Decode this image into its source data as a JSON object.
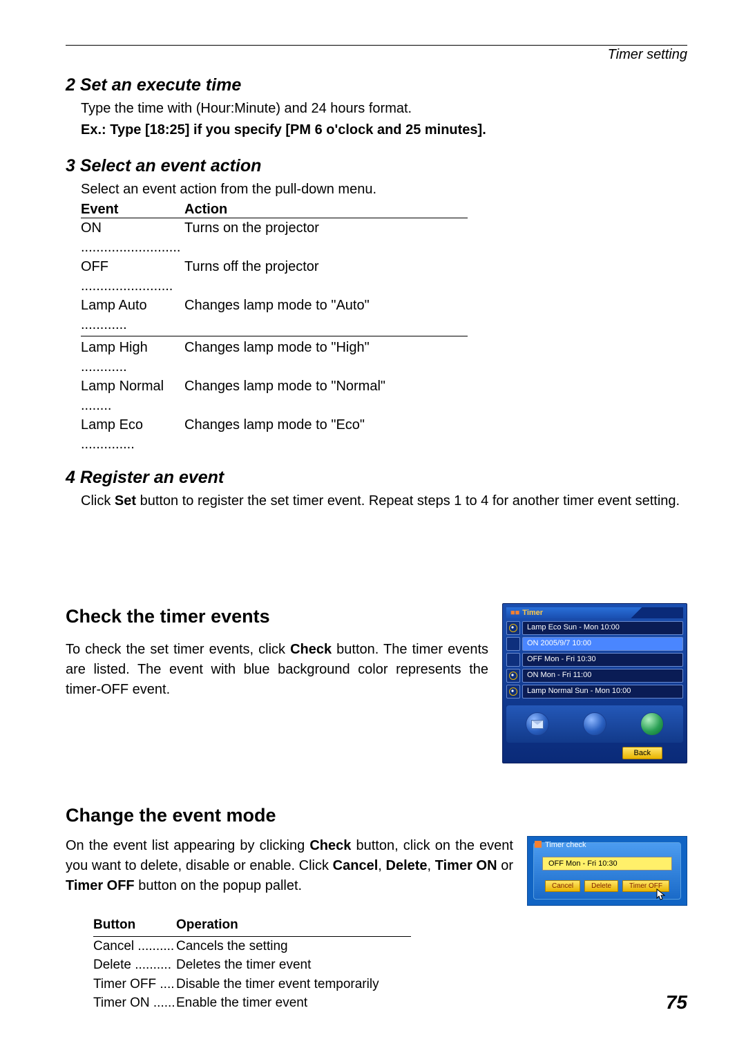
{
  "header": {
    "running_title": "Timer setting"
  },
  "step2": {
    "heading": "2 Set an execute time",
    "line1": "Type the time with (Hour:Minute) and 24 hours format.",
    "line2": "Ex.: Type [18:25] if you specify [PM 6 o'clock and 25 minutes]."
  },
  "step3": {
    "heading": "3 Select an event action",
    "intro": "Select an event action from the pull-down menu.",
    "col_event": "Event",
    "col_action": "Action",
    "rows": [
      {
        "event": "ON",
        "action": "Turns on the projector"
      },
      {
        "event": "OFF",
        "action": "Turns off the projector"
      },
      {
        "event": "Lamp Auto",
        "action": "Changes lamp mode to \"Auto\""
      },
      {
        "event": "Lamp High",
        "action": "Changes lamp mode to \"High\""
      },
      {
        "event": "Lamp Normal",
        "action": "Changes lamp mode to \"Normal\""
      },
      {
        "event": "Lamp Eco",
        "action": "Changes lamp mode to \"Eco\""
      }
    ]
  },
  "step4": {
    "heading": "4 Register an event",
    "text_pre": "Click ",
    "text_bold": "Set",
    "text_post": " button to register the set timer event. Repeat steps 1 to 4 for another timer event setting."
  },
  "check": {
    "heading": "Check the timer events",
    "text_1": "To check the set timer events, click ",
    "text_bold": "Check",
    "text_2": " button. The timer events are listed. The event with blue background color represents the timer-OFF event."
  },
  "timer_panel": {
    "title": "Timer",
    "events": [
      {
        "icon": "on",
        "label": "Lamp Eco Sun - Mon 10:00",
        "selected": false
      },
      {
        "icon": "off",
        "label": "ON 2005/9/7 10:00",
        "selected": true
      },
      {
        "icon": "off",
        "label": "OFF Mon - Fri 10:30",
        "selected": false
      },
      {
        "icon": "on",
        "label": "ON Mon - Fri 11:00",
        "selected": false
      },
      {
        "icon": "on",
        "label": "Lamp Normal Sun - Mon 10:00",
        "selected": false
      }
    ],
    "back": "Back"
  },
  "change": {
    "heading": "Change the event mode",
    "text_1": "On the event list appearing by clicking ",
    "b1": "Check",
    "text_2": " button, click on the event you want to delete, disable or enable. Click ",
    "b2": "Cancel",
    "text_3": ", ",
    "b3": "Delete",
    "text_4": ", ",
    "b4": "Timer ON",
    "text_5": " or ",
    "b5": "Timer OFF",
    "text_6": " button on the popup pallet."
  },
  "timer_check": {
    "label": "Timer check",
    "field": "OFF Mon - Fri 10:30",
    "buttons": {
      "cancel": "Cancel",
      "delete": "Delete",
      "timer_off": "Timer OFF"
    }
  },
  "button_table": {
    "col_button": "Button",
    "col_operation": "Operation",
    "rows": [
      {
        "btn": "Cancel",
        "op": "Cancels the setting"
      },
      {
        "btn": "Delete",
        "op": "Deletes the timer event"
      },
      {
        "btn": "Timer OFF",
        "op": "Disable the timer event temporarily"
      },
      {
        "btn": "Timer ON",
        "op": "Enable the timer event"
      }
    ]
  },
  "page_number": "75"
}
